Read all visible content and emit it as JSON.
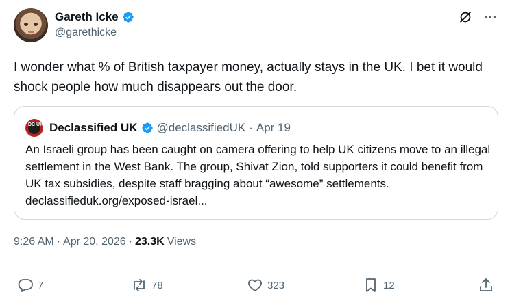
{
  "author": {
    "name": "Gareth Icke",
    "handle": "@garethicke",
    "avatar_icon": "avatar-photo"
  },
  "tweet": {
    "text": "I wonder what % of British taxpayer money, actually stays in the UK.  I bet it would shock people how much disappears out the door."
  },
  "quote": {
    "logo_text": "DC UK",
    "name": "Declassified UK",
    "handle": "@declassifiedUK",
    "separator": "·",
    "date": "Apr 19",
    "text": "An Israeli group has been caught on camera offering to help UK citizens move to an illegal settlement in the West Bank. The group, Shivat Zion, told supporters it could benefit from UK tax subsidies, despite staff bragging about “awesome” settlements. declassifieduk.org/exposed-israel..."
  },
  "meta": {
    "time": "9:26 AM",
    "separator": "·",
    "date": "Apr 20, 2026",
    "views_separator": "·",
    "views_count": "23.3K",
    "views_label": "Views"
  },
  "actions": {
    "reply_count": "7",
    "retweet_count": "78",
    "like_count": "323",
    "bookmark_count": "12"
  },
  "colors": {
    "verified": "#1d9bf0",
    "text": "#0f1419",
    "muted": "#536471",
    "border": "#cfd9de"
  }
}
